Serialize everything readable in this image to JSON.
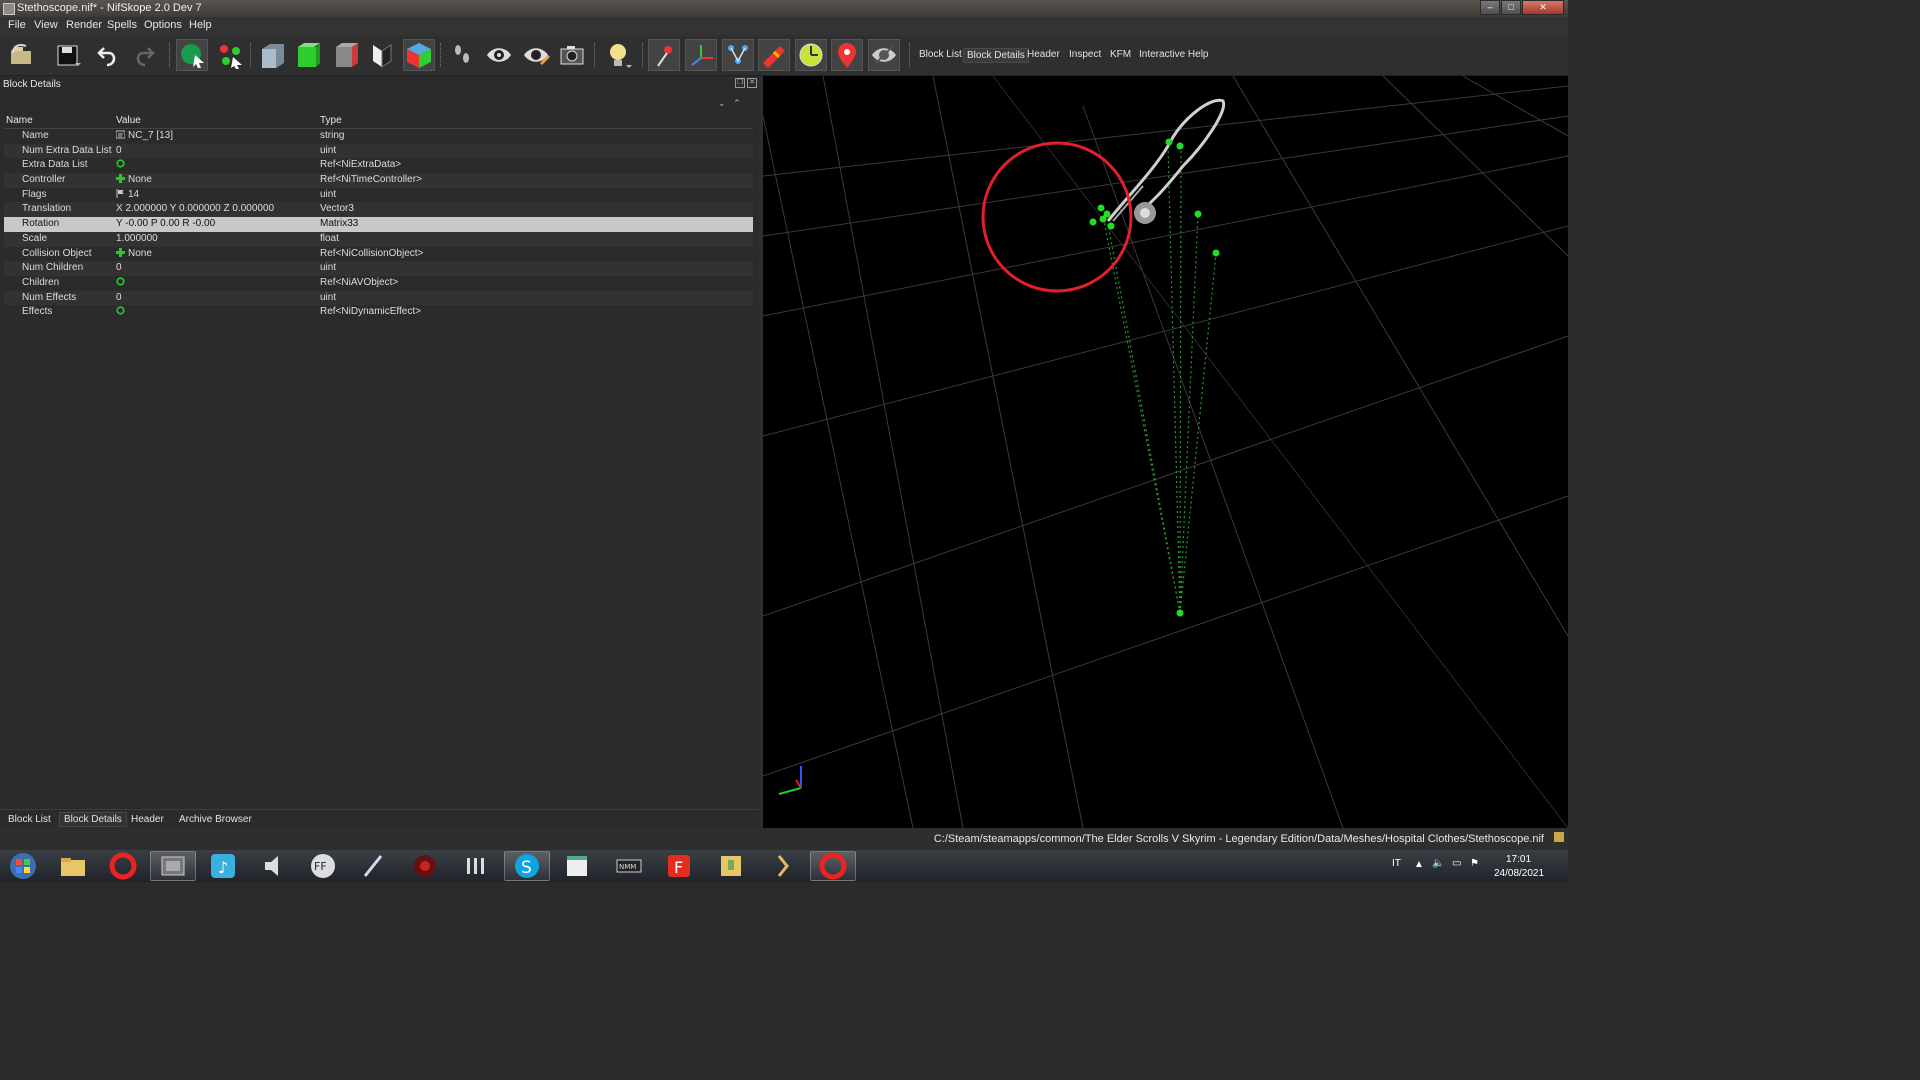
{
  "window": {
    "title": "Stethoscope.nif* - NifSkope 2.0 Dev 7"
  },
  "menu": [
    "File",
    "View",
    "Render",
    "Spells",
    "Options",
    "Help"
  ],
  "toolbar": {
    "icons": [
      "load-icon",
      "save-icon",
      "undo-icon",
      "redo-icon",
      "select-object-icon",
      "select-vertex-icon",
      "view-front-icon",
      "view-top-icon",
      "view-side-icon",
      "view-user-icon",
      "cube-icon",
      "walk-icon",
      "eye-icon",
      "eye-alt-icon",
      "screenshot-icon",
      "light-icon",
      "pin-icon",
      "axes-icon",
      "nodes-icon",
      "brush-icon",
      "radar-icon",
      "marker-icon",
      "hide-icon"
    ],
    "tabs": [
      "Block List",
      "Block Details",
      "Header",
      "Inspect",
      "KFM",
      "Interactive Help"
    ],
    "active_tab": "Block Details"
  },
  "panel": {
    "title": "Block Details",
    "columns": [
      "Name",
      "Value",
      "Type"
    ],
    "rows": [
      {
        "name": "Name",
        "value": "NC_7 [13]",
        "type": "string",
        "icon": "text-icon"
      },
      {
        "name": "Num Extra Data List",
        "value": "0",
        "type": "uint",
        "icon": ""
      },
      {
        "name": "Extra Data List",
        "value": "",
        "type": "Ref<NiExtraData>",
        "icon": "link-icon"
      },
      {
        "name": "Controller",
        "value": "None",
        "type": "Ref<NiTimeController>",
        "icon": "plus-icon"
      },
      {
        "name": "Flags",
        "value": "14",
        "type": "uint",
        "icon": "flag-icon"
      },
      {
        "name": "Translation",
        "value": "X 2.000000 Y 0.000000 Z 0.000000",
        "type": "Vector3",
        "icon": ""
      },
      {
        "name": "Rotation",
        "value": "Y -0.00 P 0.00 R -0.00",
        "type": "Matrix33",
        "icon": ""
      },
      {
        "name": "Scale",
        "value": "1.000000",
        "type": "float",
        "icon": ""
      },
      {
        "name": "Collision Object",
        "value": "None",
        "type": "Ref<NiCollisionObject>",
        "icon": "plus-icon"
      },
      {
        "name": "Num Children",
        "value": "0",
        "type": "uint",
        "icon": ""
      },
      {
        "name": "Children",
        "value": "",
        "type": "Ref<NiAVObject>",
        "icon": "link-icon"
      },
      {
        "name": "Num Effects",
        "value": "0",
        "type": "uint",
        "icon": ""
      },
      {
        "name": "Effects",
        "value": "",
        "type": "Ref<NiDynamicEffect>",
        "icon": "link-icon"
      }
    ],
    "selected_row": "Rotation"
  },
  "bottom_tabs": [
    "Block List",
    "Block Details",
    "Header",
    "Archive Browser"
  ],
  "active_bottom_tab": "Block Details",
  "status": {
    "path": "C:/Steam/steamapps/common/The Elder Scrolls V Skyrim - Legendary Edition/Data/Meshes/Hospital Clothes/Stethoscope.nif"
  },
  "taskbar": {
    "apps": [
      "start-button",
      "explorer",
      "opera",
      "nifskope",
      "itunes",
      "audio",
      "ffdec",
      "quill",
      "game",
      "misc",
      "skype",
      "notepad",
      "nmm",
      "foxit",
      "archive",
      "unknown",
      "opera2"
    ],
    "language": "IT",
    "time": "17:01",
    "date": "24/08/2021"
  },
  "colors": {
    "accent_green": "#22dd22",
    "highlight_red": "#e0202a",
    "selection": "#c8c8c8"
  }
}
